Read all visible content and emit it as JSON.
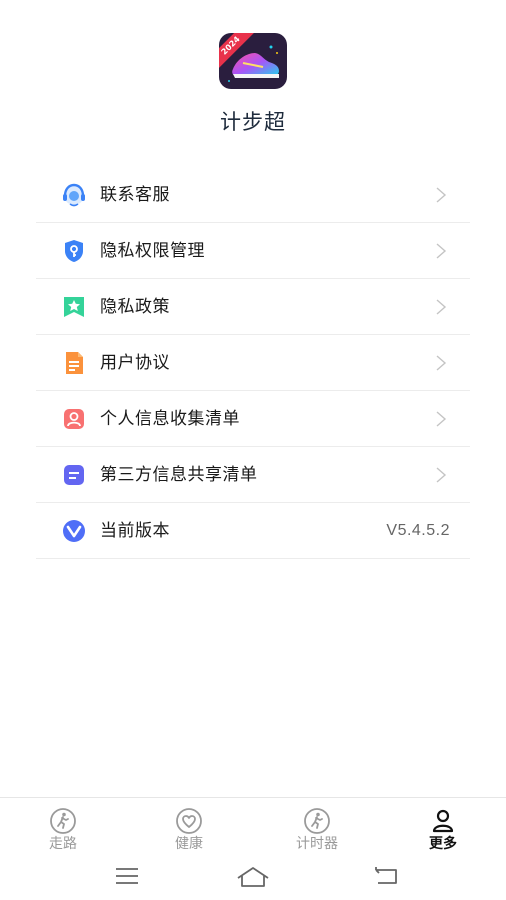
{
  "app": {
    "title": "计步超",
    "icon_badge": "2024"
  },
  "menu": {
    "items": [
      {
        "label": "联系客服",
        "icon": "headset-icon",
        "chevron": true
      },
      {
        "label": "隐私权限管理",
        "icon": "shield-key-icon",
        "chevron": true
      },
      {
        "label": "隐私政策",
        "icon": "star-bookmark-icon",
        "chevron": true
      },
      {
        "label": "用户协议",
        "icon": "document-icon",
        "chevron": true
      },
      {
        "label": "个人信息收集清单",
        "icon": "user-card-icon",
        "chevron": true
      },
      {
        "label": "第三方信息共享清单",
        "icon": "list-card-icon",
        "chevron": true
      },
      {
        "label": "当前版本",
        "icon": "version-v-icon",
        "value": "V5.4.5.2"
      }
    ]
  },
  "tabbar": {
    "tabs": [
      {
        "label": "走路",
        "icon": "walking-icon",
        "active": false
      },
      {
        "label": "健康",
        "icon": "heart-icon",
        "active": false
      },
      {
        "label": "计时器",
        "icon": "walking-icon",
        "active": false
      },
      {
        "label": "更多",
        "icon": "person-icon",
        "active": true
      }
    ]
  },
  "colors": {
    "accent_blue": "#3b82f6",
    "chevron": "#c4c4c4",
    "tab_inactive": "#9a9a9a",
    "tab_active": "#111111"
  }
}
